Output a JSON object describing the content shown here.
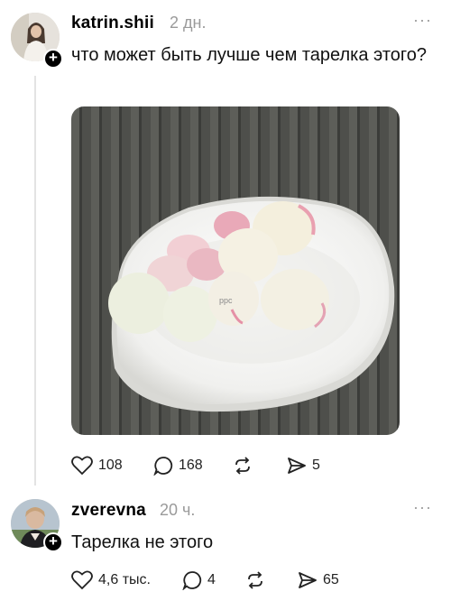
{
  "post": {
    "username": "katrin.shii",
    "time": "2 дн.",
    "more": "···",
    "text": "что может быть лучше чем тарелка этого?",
    "photo_watermark": "ppc",
    "actions": {
      "likes": "108",
      "comments": "168",
      "repost": "",
      "shares": "5"
    }
  },
  "reply": {
    "username": "zverevna",
    "time": "20 ч.",
    "more": "···",
    "text": "Тарелка не этого",
    "actions": {
      "likes": "4,6 тыс.",
      "comments": "4",
      "repost": "",
      "shares": "65"
    }
  },
  "icons": {
    "follow": "plus-icon",
    "like": "heart-icon",
    "comment": "comment-bubble-icon",
    "repost": "repost-icon",
    "share": "send-icon",
    "more": "more-icon"
  },
  "colors": {
    "background": "#ffffff",
    "muted": "#9a9a9a",
    "thread_line": "#e3e3e3"
  }
}
